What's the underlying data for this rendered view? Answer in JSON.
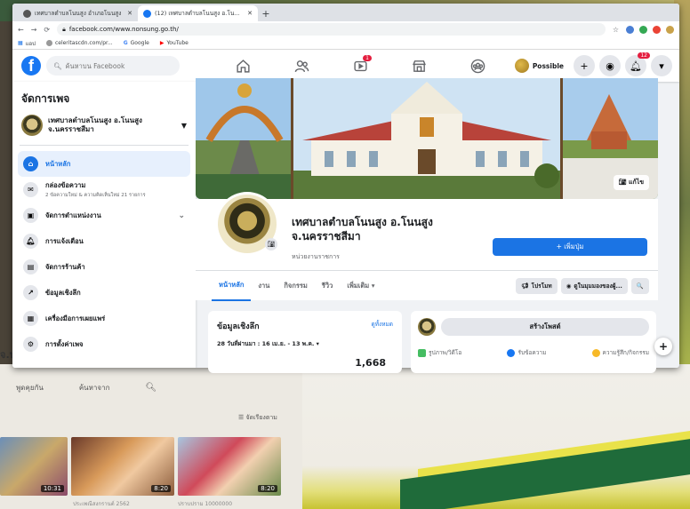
{
  "browser": {
    "tabs": [
      {
        "title": "เทศบาลตำบลโนนสูง อำเภอโนนสูง",
        "active": false
      },
      {
        "title": "(12) เทศบาลตำบลโนนสูง อ.โนนสูง",
        "active": true
      }
    ],
    "new_tab": "+",
    "url": "facebook.com/www.nonsung.go.th/",
    "bookmarks": [
      "แอป",
      "celeritascdn.com/pr...",
      "Google",
      "YouTube"
    ]
  },
  "fb_nav": {
    "search_placeholder": "ค้นหาบน Facebook",
    "video_badge": "1",
    "profile_name": "Possible",
    "plus": "+",
    "notif_badge": "12"
  },
  "sidebar": {
    "title": "จัดการเพจ",
    "page_name": "เทศบาลตำบลโนนสูง อ.โนนสูง จ.นครราชสีมา",
    "items": [
      {
        "label": "หน้าหลัก",
        "active": true,
        "icon": "home-icon"
      },
      {
        "label": "กล่องข้อความ",
        "sub": "2 ข้อความใหม่ & ความคิดเห็นใหม่ 21 รายการ",
        "icon": "inbox-icon"
      },
      {
        "label": "จัดการตำแหน่งงาน",
        "chevron": true,
        "icon": "briefcase-icon"
      },
      {
        "label": "การแจ้งเตือน",
        "icon": "bell-icon"
      },
      {
        "label": "จัดการร้านค้า",
        "icon": "shop-icon"
      },
      {
        "label": "ข้อมูลเชิงลึก",
        "icon": "insights-icon"
      },
      {
        "label": "เครื่องมือการเผยแพร่",
        "icon": "publishing-icon"
      },
      {
        "label": "การตั้งค่าเพจ",
        "icon": "gear-icon"
      }
    ]
  },
  "page": {
    "edit_cover": "แก้ไข",
    "name": "เทศบาลตำบลโนนสูง อ.โนนสูง จ.นครราชสีมา",
    "category": "หน่วยงานราชการ",
    "add_button": "+ เพิ่มปุ่ม",
    "tabs": [
      "หน้าหลัก",
      "งาน",
      "กิจกรรม",
      "รีวิว",
      "เพิ่มเติม ▾"
    ],
    "promote": "โปรโมท",
    "view_as": "ดูในมุมมองของผู้...",
    "search": "🔍"
  },
  "insights": {
    "title": "ข้อมูลเชิงลึก",
    "see_all": "ดูทั้งหมด",
    "range": "28 วันที่ผ่านมา : 16 เม.ย. - 13 พ.ค. ▾",
    "value": "1,668"
  },
  "create_post": {
    "button": "สร้างโพสต์",
    "options": [
      "รูปภาพ/วิดีโอ",
      "รับข้อความ",
      "ความรู้สึก/กิจกรรม"
    ]
  },
  "lower_page": {
    "tabs": [
      "พูดคุยกัน",
      "ค้นหาจาก"
    ],
    "sort": "จัดเรียงตาม",
    "durations": [
      "10:31",
      "8:20",
      "8:20"
    ],
    "captions": [
      "ประเพณีสงกรานต์ 2562",
      "ปราบปราม 10000000"
    ],
    "edge_text": "จ.น"
  },
  "colors": {
    "fb_blue": "#1877f2",
    "badge_red": "#e41e3f"
  }
}
